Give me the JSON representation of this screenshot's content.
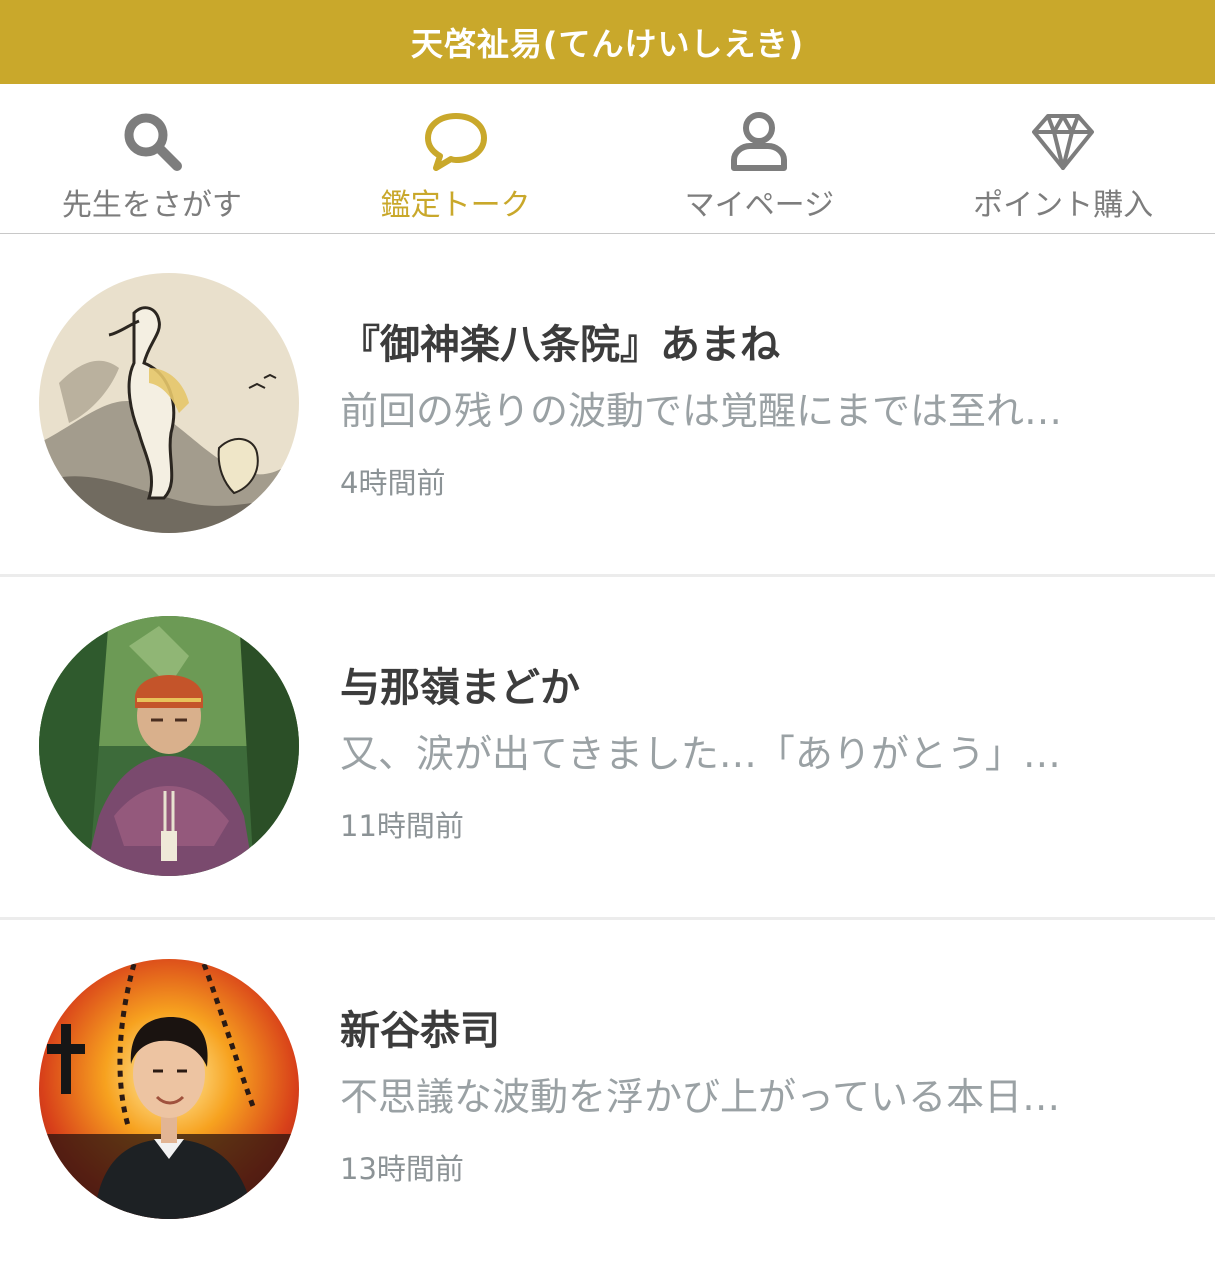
{
  "header": {
    "title": "天啓祉易(てんけいしえき)"
  },
  "nav": {
    "items": [
      {
        "label": "先生をさがす",
        "icon": "search-icon",
        "active": false
      },
      {
        "label": "鑑定トーク",
        "icon": "chat-bubble-icon",
        "active": true
      },
      {
        "label": "マイページ",
        "icon": "user-icon",
        "active": false
      },
      {
        "label": "ポイント購入",
        "icon": "diamond-icon",
        "active": false
      }
    ]
  },
  "conversations": [
    {
      "name": "『御神楽八条院』あまね",
      "preview": "前回の残りの波動では覚醒にまでは至れ…",
      "time": "4時間前"
    },
    {
      "name": "与那嶺まどか",
      "preview": "又、涙が出てきました…「ありがとう」…",
      "time": "11時間前"
    },
    {
      "name": "新谷恭司",
      "preview": "不思議な波動を浮かび上がっている本日…",
      "time": "13時間前"
    }
  ],
  "colors": {
    "accent": "#c9a82b",
    "nav_inactive": "#7d7d7d",
    "name_text": "#3c3c3c",
    "preview_text": "#9aa1a4",
    "divider": "#ececec"
  }
}
